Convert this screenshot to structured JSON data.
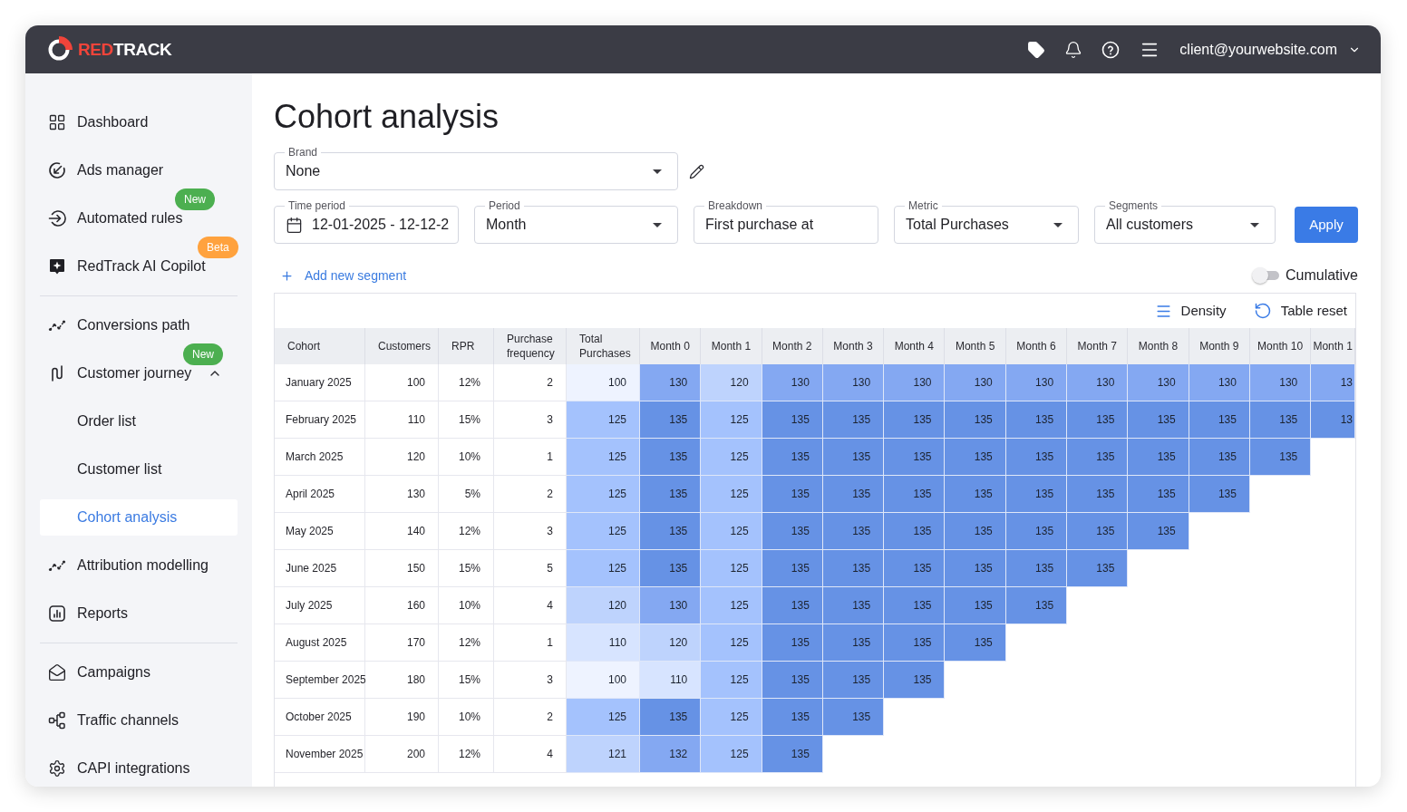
{
  "header": {
    "logo": {
      "parts": [
        {
          "text": "RED",
          "color": "#f0443a"
        },
        {
          "text": "TRACK",
          "color": "#ffffff"
        }
      ]
    },
    "account": "client@yourwebsite.com"
  },
  "sidebar": {
    "sections": [
      {
        "items": [
          {
            "label": "Dashboard",
            "selected": false
          },
          {
            "label": "Ads manager",
            "selected": false
          },
          {
            "label": "Automated rules",
            "selected": false,
            "badge": {
              "label": "New",
              "color": "#4caf50"
            }
          },
          {
            "label": "RedTrack AI Copilot",
            "selected": false,
            "badge": {
              "label": "Beta",
              "color": "#ffa23e"
            }
          }
        ]
      },
      {
        "items": [
          {
            "label": "Conversions path",
            "selected": false
          },
          {
            "label": "Customer journey",
            "selected": false,
            "expanded": true,
            "badge": {
              "label": "New",
              "color": "#4caf50"
            },
            "children": [
              {
                "label": "Order list",
                "selected": false
              },
              {
                "label": "Customer list",
                "selected": false
              },
              {
                "label": "Cohort analysis",
                "selected": true
              }
            ]
          },
          {
            "label": "Attribution modelling",
            "selected": false
          },
          {
            "label": "Reports",
            "selected": false
          }
        ]
      },
      {
        "items": [
          {
            "label": "Campaigns",
            "selected": false
          },
          {
            "label": "Traffic channels",
            "selected": false
          },
          {
            "label": "CAPI integrations",
            "selected": false
          }
        ]
      }
    ]
  },
  "page_title": "Cohort analysis",
  "brand_field": {
    "label": "Brand",
    "value": "None",
    "kind": "select"
  },
  "filters": [
    {
      "label": "Time period",
      "value": "12-01-2025 - 12-12-2",
      "kind": "date"
    },
    {
      "label": "Period",
      "value": "Month",
      "kind": "select"
    },
    {
      "label": "Breakdown",
      "value": "First purchase at",
      "kind": "text"
    },
    {
      "label": "Metric",
      "value": "Total Purchases",
      "kind": "select"
    },
    {
      "label": "Segments",
      "value": "All customers",
      "kind": "select"
    }
  ],
  "apply_button": "Apply",
  "add_segment_link": "Add new segment",
  "cumulative_toggle": {
    "label": "Cumulative",
    "on": false
  },
  "table": {
    "toolbar": [
      {
        "label": "Density"
      },
      {
        "label": "Table reset"
      }
    ],
    "columns": [
      {
        "label": "Cohort",
        "kind": "text"
      },
      {
        "label": "Customers",
        "kind": "number"
      },
      {
        "label": "RPR",
        "kind": "number"
      },
      {
        "label": "Purchase frequency",
        "kind": "number"
      },
      {
        "label": "Total Purchases",
        "kind": "heat"
      },
      {
        "label": "Month 0",
        "kind": "period"
      },
      {
        "label": "Month 1",
        "kind": "period"
      },
      {
        "label": "Month 2",
        "kind": "period"
      },
      {
        "label": "Month 3",
        "kind": "period"
      },
      {
        "label": "Month 4",
        "kind": "period"
      },
      {
        "label": "Month 5",
        "kind": "period"
      },
      {
        "label": "Month 6",
        "kind": "period"
      },
      {
        "label": "Month 7",
        "kind": "period"
      },
      {
        "label": "Month 8",
        "kind": "period"
      },
      {
        "label": "Month 9",
        "kind": "period"
      },
      {
        "label": "Month 10",
        "kind": "period"
      },
      {
        "label": "Month 1",
        "kind": "period"
      }
    ],
    "rows": [
      {
        "cells": [
          "January 2025",
          "100",
          "12%",
          "2",
          {
            "value": "100",
            "color": "#eef3ff"
          },
          {
            "value": "130",
            "color": "#84a8f2"
          },
          {
            "value": "120",
            "color": "#bed3fd"
          },
          {
            "value": "130",
            "color": "#84a8f2"
          },
          {
            "value": "130",
            "color": "#84a8f2"
          },
          {
            "value": "130",
            "color": "#84a8f2"
          },
          {
            "value": "130",
            "color": "#84a8f2"
          },
          {
            "value": "130",
            "color": "#84a8f2"
          },
          {
            "value": "130",
            "color": "#84a8f2"
          },
          {
            "value": "130",
            "color": "#84a8f2"
          },
          {
            "value": "130",
            "color": "#84a8f2"
          },
          {
            "value": "130",
            "color": "#84a8f2"
          },
          {
            "value": "13",
            "color": "#84a8f2"
          }
        ]
      },
      {
        "cells": [
          "February 2025",
          "110",
          "15%",
          "3",
          {
            "value": "125",
            "color": "#a4c2fd"
          },
          {
            "value": "135",
            "color": "#6692e5"
          },
          {
            "value": "125",
            "color": "#a4c2fd"
          },
          {
            "value": "135",
            "color": "#6692e5"
          },
          {
            "value": "135",
            "color": "#6692e5"
          },
          {
            "value": "135",
            "color": "#6692e5"
          },
          {
            "value": "135",
            "color": "#6692e5"
          },
          {
            "value": "135",
            "color": "#6692e5"
          },
          {
            "value": "135",
            "color": "#6692e5"
          },
          {
            "value": "135",
            "color": "#6692e5"
          },
          {
            "value": "135",
            "color": "#6692e5"
          },
          {
            "value": "135",
            "color": "#6692e5"
          },
          {
            "value": "13",
            "color": "#6692e5"
          }
        ]
      },
      {
        "cells": [
          "March 2025",
          "120",
          "10%",
          "1",
          {
            "value": "125",
            "color": "#a4c2fd"
          },
          {
            "value": "135",
            "color": "#6692e5"
          },
          {
            "value": "125",
            "color": "#a4c2fd"
          },
          {
            "value": "135",
            "color": "#6692e5"
          },
          {
            "value": "135",
            "color": "#6692e5"
          },
          {
            "value": "135",
            "color": "#6692e5"
          },
          {
            "value": "135",
            "color": "#6692e5"
          },
          {
            "value": "135",
            "color": "#6692e5"
          },
          {
            "value": "135",
            "color": "#6692e5"
          },
          {
            "value": "135",
            "color": "#6692e5"
          },
          {
            "value": "135",
            "color": "#6692e5"
          },
          {
            "value": "135",
            "color": "#6692e5"
          }
        ]
      },
      {
        "cells": [
          "April 2025",
          "130",
          "5%",
          "2",
          {
            "value": "125",
            "color": "#a4c2fd"
          },
          {
            "value": "135",
            "color": "#6692e5"
          },
          {
            "value": "125",
            "color": "#a4c2fd"
          },
          {
            "value": "135",
            "color": "#6692e5"
          },
          {
            "value": "135",
            "color": "#6692e5"
          },
          {
            "value": "135",
            "color": "#6692e5"
          },
          {
            "value": "135",
            "color": "#6692e5"
          },
          {
            "value": "135",
            "color": "#6692e5"
          },
          {
            "value": "135",
            "color": "#6692e5"
          },
          {
            "value": "135",
            "color": "#6692e5"
          },
          {
            "value": "135",
            "color": "#6692e5"
          }
        ]
      },
      {
        "cells": [
          "May 2025",
          "140",
          "12%",
          "3",
          {
            "value": "125",
            "color": "#a4c2fd"
          },
          {
            "value": "135",
            "color": "#6692e5"
          },
          {
            "value": "125",
            "color": "#a4c2fd"
          },
          {
            "value": "135",
            "color": "#6692e5"
          },
          {
            "value": "135",
            "color": "#6692e5"
          },
          {
            "value": "135",
            "color": "#6692e5"
          },
          {
            "value": "135",
            "color": "#6692e5"
          },
          {
            "value": "135",
            "color": "#6692e5"
          },
          {
            "value": "135",
            "color": "#6692e5"
          },
          {
            "value": "135",
            "color": "#6692e5"
          }
        ]
      },
      {
        "cells": [
          "June 2025",
          "150",
          "15%",
          "5",
          {
            "value": "125",
            "color": "#a4c2fd"
          },
          {
            "value": "135",
            "color": "#6692e5"
          },
          {
            "value": "125",
            "color": "#a4c2fd"
          },
          {
            "value": "135",
            "color": "#6692e5"
          },
          {
            "value": "135",
            "color": "#6692e5"
          },
          {
            "value": "135",
            "color": "#6692e5"
          },
          {
            "value": "135",
            "color": "#6692e5"
          },
          {
            "value": "135",
            "color": "#6692e5"
          },
          {
            "value": "135",
            "color": "#6692e5"
          }
        ]
      },
      {
        "cells": [
          "July 2025",
          "160",
          "10%",
          "4",
          {
            "value": "120",
            "color": "#bed3fd"
          },
          {
            "value": "130",
            "color": "#84a8f2"
          },
          {
            "value": "125",
            "color": "#a4c2fd"
          },
          {
            "value": "135",
            "color": "#6692e5"
          },
          {
            "value": "135",
            "color": "#6692e5"
          },
          {
            "value": "135",
            "color": "#6692e5"
          },
          {
            "value": "135",
            "color": "#6692e5"
          },
          {
            "value": "135",
            "color": "#6692e5"
          }
        ]
      },
      {
        "cells": [
          "August 2025",
          "170",
          "12%",
          "1",
          {
            "value": "110",
            "color": "#d7e4ff"
          },
          {
            "value": "120",
            "color": "#bed3fd"
          },
          {
            "value": "125",
            "color": "#a4c2fd"
          },
          {
            "value": "135",
            "color": "#6692e5"
          },
          {
            "value": "135",
            "color": "#6692e5"
          },
          {
            "value": "135",
            "color": "#6692e5"
          },
          {
            "value": "135",
            "color": "#6692e5"
          }
        ]
      },
      {
        "cells": [
          "September 2025",
          "180",
          "15%",
          "3",
          {
            "value": "100",
            "color": "#eef3ff"
          },
          {
            "value": "110",
            "color": "#d7e4ff"
          },
          {
            "value": "125",
            "color": "#a4c2fd"
          },
          {
            "value": "135",
            "color": "#6692e5"
          },
          {
            "value": "135",
            "color": "#6692e5"
          },
          {
            "value": "135",
            "color": "#6692e5"
          }
        ]
      },
      {
        "cells": [
          "October 2025",
          "190",
          "10%",
          "2",
          {
            "value": "125",
            "color": "#a4c2fd"
          },
          {
            "value": "135",
            "color": "#6692e5"
          },
          {
            "value": "125",
            "color": "#a4c2fd"
          },
          {
            "value": "135",
            "color": "#6692e5"
          },
          {
            "value": "135",
            "color": "#6692e5"
          }
        ]
      },
      {
        "cells": [
          "November 2025",
          "200",
          "12%",
          "4",
          {
            "value": "121",
            "color": "#bed3fd"
          },
          {
            "value": "132",
            "color": "#84a8f2"
          },
          {
            "value": "125",
            "color": "#a4c2fd"
          },
          {
            "value": "135",
            "color": "#6692e5"
          }
        ]
      }
    ]
  }
}
